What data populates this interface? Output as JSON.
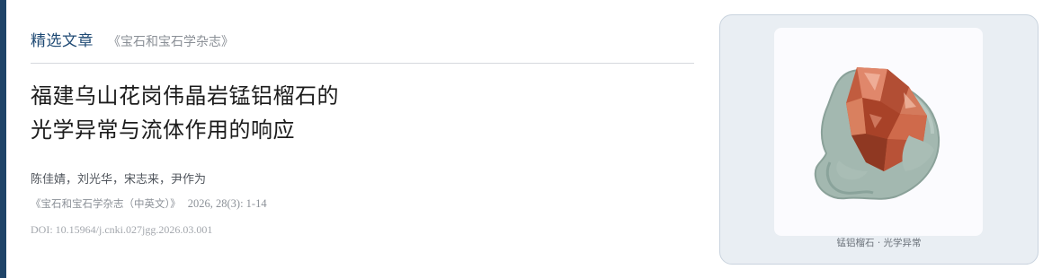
{
  "header": {
    "section_label": "精选文章",
    "journal_label": "《宝石和宝石学杂志》"
  },
  "article": {
    "title_line1": "福建乌山花岗伟晶岩锰铝榴石的",
    "title_line2": "光学异常与流体作用的响应",
    "authors": "陈佳婧，刘光华，宋志来，尹作为",
    "citation_journal": "《宝石和宝石学杂志（中英文）》",
    "citation_detail": "2026, 28(3): 1-14",
    "doi": "DOI: 10.15964/j.cnki.027jgg.2026.03.001"
  },
  "figure": {
    "caption": "锰铝榴石 · 光学异常",
    "image_icon": "garnet-crystal-icon"
  },
  "colors": {
    "accent": "#1f4468",
    "section_label": "#1f4a74",
    "card_background": "#e9eef3",
    "crystal": "#c05a3e",
    "matrix": "#9eb5ad"
  }
}
